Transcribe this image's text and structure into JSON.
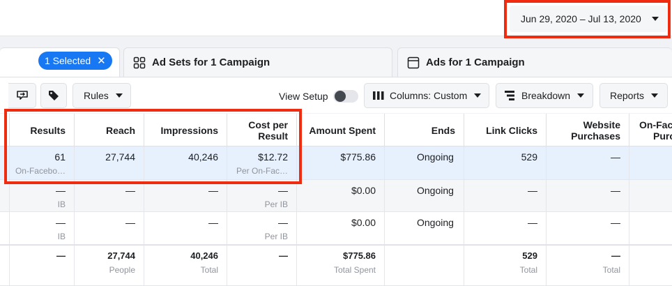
{
  "date_range": {
    "label": "Jun 29, 2020 – Jul 13, 2020"
  },
  "tabs": {
    "selected_chip": "1 Selected",
    "selected_close": "✕",
    "adsets": "Ad Sets for 1 Campaign",
    "ads": "Ads for 1 Campaign"
  },
  "toolbar": {
    "rules": "Rules",
    "view_setup": "View Setup",
    "columns": "Columns: Custom",
    "breakdown": "Breakdown",
    "reports": "Reports"
  },
  "columns": [
    "Results",
    "Reach",
    "Impressions",
    "Cost per Result",
    "Amount Spent",
    "Ends",
    "Link Clicks",
    "Website Purchases",
    "On-Facebook Purchases"
  ],
  "column_display": {
    "results": "Results",
    "reach": "Reach",
    "impressions": "Impressions",
    "cost_per_result_1": "Cost per",
    "cost_per_result_2": "Result",
    "amount_spent": "Amount Spent",
    "ends": "Ends",
    "link_clicks": "Link Clicks",
    "website_purchases_1": "Website",
    "website_purchases_2": "Purchases",
    "on_fb_1": "On-Face",
    "on_fb_2": "Purc"
  },
  "rows": [
    {
      "results": "61",
      "results_sub": "On-Facebo…",
      "reach": "27,744",
      "impressions": "40,246",
      "cpr": "$12.72",
      "cpr_sub": "Per On-Fac…",
      "spent": "$775.86",
      "ends": "Ongoing",
      "clicks": "529",
      "web": "—"
    },
    {
      "results": "—",
      "results_sub": "IB",
      "reach": "—",
      "impressions": "—",
      "cpr": "—",
      "cpr_sub": "Per IB",
      "spent": "$0.00",
      "ends": "Ongoing",
      "clicks": "—",
      "web": "—"
    },
    {
      "results": "—",
      "results_sub": "IB",
      "reach": "—",
      "impressions": "—",
      "cpr": "—",
      "cpr_sub": "Per IB",
      "spent": "$0.00",
      "ends": "Ongoing",
      "clicks": "—",
      "web": "—"
    }
  ],
  "totals": {
    "results": "—",
    "reach": "27,744",
    "reach_sub": "People",
    "impressions": "40,246",
    "impressions_sub": "Total",
    "cpr": "—",
    "spent": "$775.86",
    "spent_sub": "Total Spent",
    "clicks": "529",
    "clicks_sub": "Total",
    "web": "—",
    "web_sub": "Total"
  },
  "colors": {
    "accent": "#1877f2",
    "highlight": "#f02c10",
    "selected_row": "#e7f0fd"
  }
}
